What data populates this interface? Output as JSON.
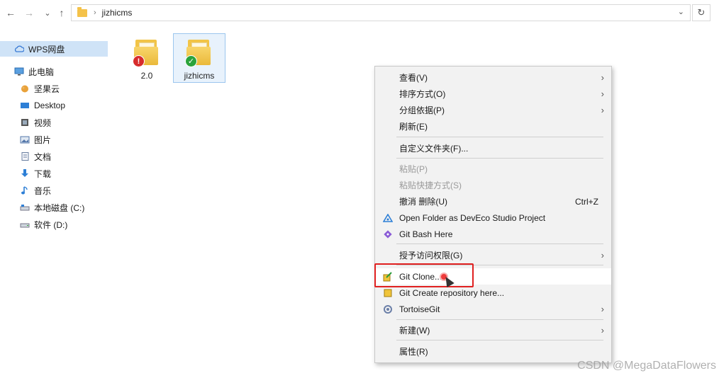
{
  "address_bar": {
    "path_separator": "›",
    "folder_name": "jizhicms",
    "dropdown_glyph": "⌄",
    "refresh_glyph": "↻"
  },
  "nav_buttons": {
    "back": "←",
    "forward": "→",
    "recent": "⌄",
    "up": "↑"
  },
  "navpane": {
    "items": [
      {
        "label": "WPS网盘",
        "icon": "cloud-icon"
      },
      {
        "label": "此电脑",
        "icon": "computer-icon"
      },
      {
        "label": "坚果云",
        "icon": "nut-cloud-icon"
      },
      {
        "label": "Desktop",
        "icon": "desktop-icon"
      },
      {
        "label": "视频",
        "icon": "video-icon"
      },
      {
        "label": "图片",
        "icon": "pictures-icon"
      },
      {
        "label": "文档",
        "icon": "documents-icon"
      },
      {
        "label": "下载",
        "icon": "download-icon"
      },
      {
        "label": "音乐",
        "icon": "music-icon"
      },
      {
        "label": "本地磁盘 (C:)",
        "icon": "disk-c-icon"
      },
      {
        "label": "软件 (D:)",
        "icon": "disk-d-icon"
      }
    ]
  },
  "files": [
    {
      "label": "2.0",
      "status": "conflict"
    },
    {
      "label": "jizhicms",
      "status": "normal"
    }
  ],
  "context_menu": {
    "view": "查看(V)",
    "sort": "排序方式(O)",
    "group": "分组依据(P)",
    "refresh": "刷新(E)",
    "customize": "自定义文件夹(F)...",
    "paste": "粘贴(P)",
    "paste_shortcut": "粘贴快捷方式(S)",
    "undo_delete": "撤消 删除(U)",
    "undo_shortcut": "Ctrl+Z",
    "open_deveco": "Open Folder as DevEco Studio Project",
    "git_bash": "Git Bash Here",
    "grant_access": "授予访问权限(G)",
    "git_clone": "Git Clone...",
    "git_create": "Git Create repository here...",
    "tortoisegit": "TortoiseGit",
    "new": "新建(W)",
    "properties": "属性(R)",
    "submenu_arrow": "›"
  },
  "colors": {
    "selection": "#cfe3f7",
    "highlight_border": "#e02020",
    "menu_bg": "#f2f2f2"
  },
  "watermark": "CSDN @MegaDataFlowers"
}
